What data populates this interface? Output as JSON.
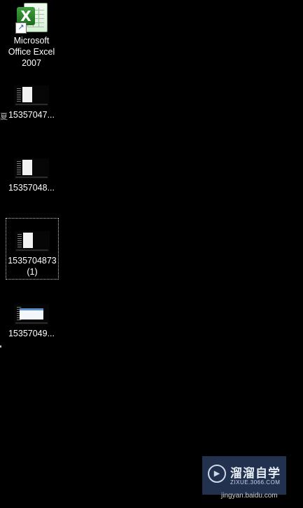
{
  "desktop": {
    "icons": [
      {
        "label": "Microsoft Office Excel 2007",
        "icon": "excel-shortcut-icon"
      },
      {
        "label": "15357047...",
        "icon": "screenshot-thumbnail-icon"
      },
      {
        "label": "15357048...",
        "icon": "screenshot-thumbnail-icon"
      },
      {
        "label": "1535704873 (1)",
        "icon": "screenshot-thumbnail-icon",
        "selected": true
      },
      {
        "label": "15357049...",
        "icon": "screenshot-thumbnail-icon"
      }
    ],
    "edge_glyph": "夏"
  },
  "watermark": {
    "title": "溜溜自学",
    "subtitle": "ZIXUE.3066.COM",
    "play_symbol": "▶"
  },
  "footer": {
    "source": "jingyan.baidu.com"
  },
  "colors": {
    "background": "#000000",
    "label_text": "#ffffff",
    "watermark_bg": "#283a5c"
  }
}
